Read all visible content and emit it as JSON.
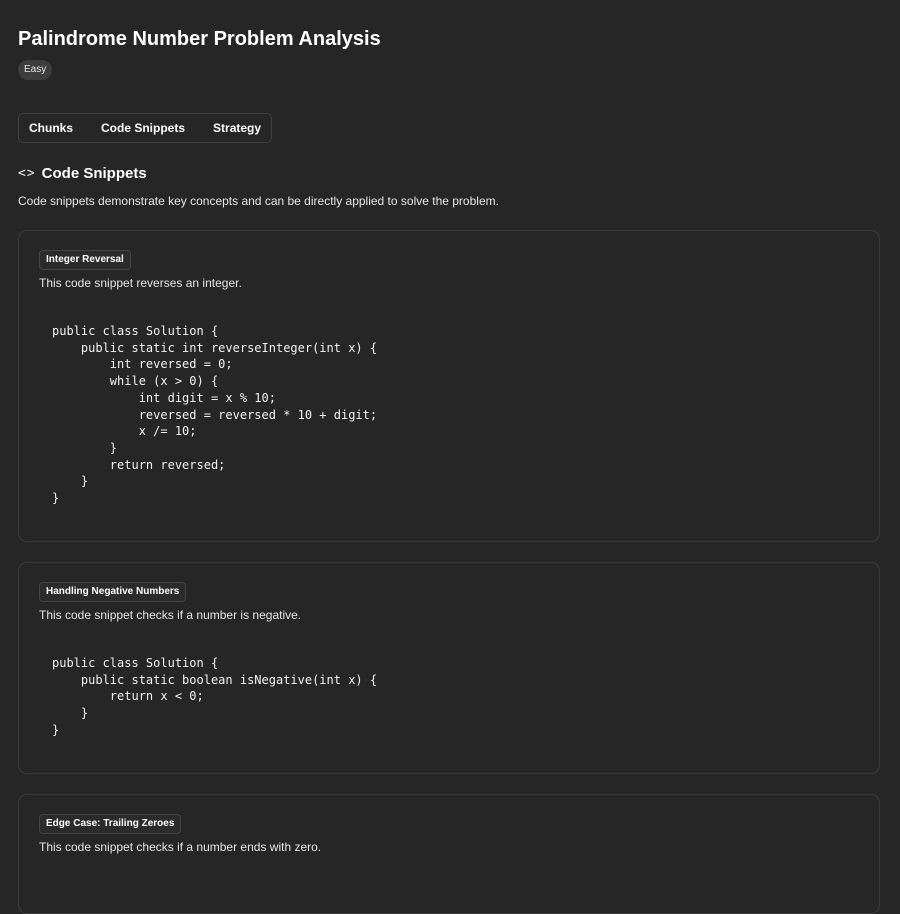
{
  "header": {
    "title": "Palindrome Number Problem Analysis",
    "difficulty": "Easy"
  },
  "tabs": [
    {
      "label": "Chunks"
    },
    {
      "label": "Code Snippets"
    },
    {
      "label": "Strategy"
    }
  ],
  "section": {
    "icon": "code-icon",
    "title": "Code Snippets",
    "description": "Code snippets demonstrate key concepts and can be directly applied to solve the problem."
  },
  "snippets": [
    {
      "tag": "Integer Reversal",
      "description": "This code snippet reverses an integer.",
      "code": "public class Solution {\n    public static int reverseInteger(int x) {\n        int reversed = 0;\n        while (x > 0) {\n            int digit = x % 10;\n            reversed = reversed * 10 + digit;\n            x /= 10;\n        }\n        return reversed;\n    }\n}"
    },
    {
      "tag": "Handling Negative Numbers",
      "description": "This code snippet checks if a number is negative.",
      "code": "public class Solution {\n    public static boolean isNegative(int x) {\n        return x < 0;\n    }\n}"
    },
    {
      "tag": "Edge Case: Trailing Zeroes",
      "description": "This code snippet checks if a number ends with zero.",
      "code": ""
    }
  ]
}
